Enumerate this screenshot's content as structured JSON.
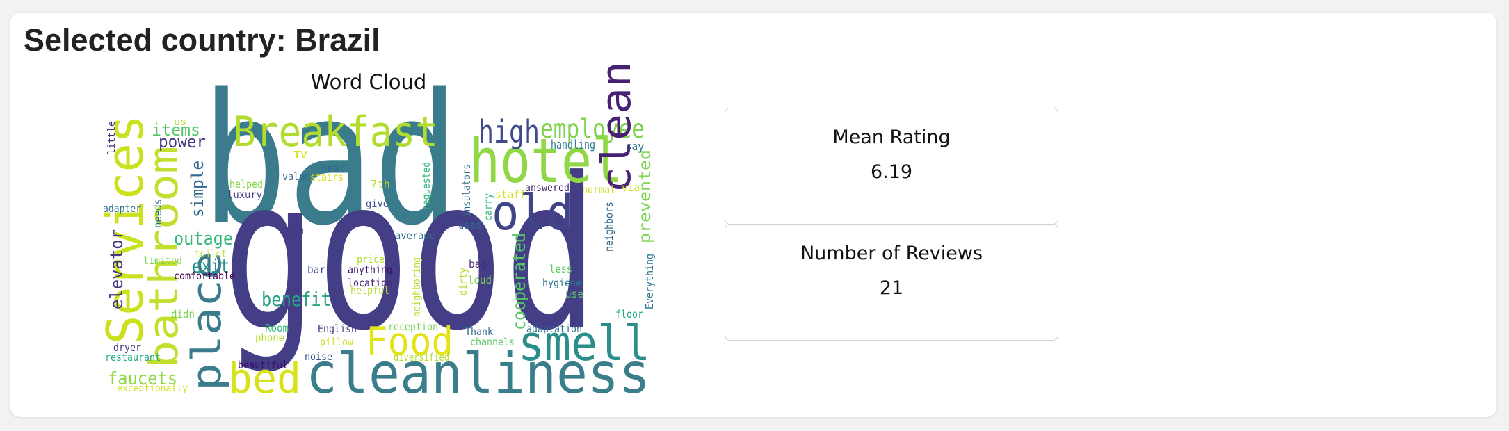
{
  "page": {
    "title": "Selected country: Brazil"
  },
  "wordcloud": {
    "title": "Word Cloud",
    "palette": {
      "dark_navy": "#433e85",
      "purple": "#482173",
      "teal": "#3a7e8c",
      "green": "#2fb47c",
      "light_green": "#8fd744",
      "lime": "#c3df2e",
      "yellow": "#e6e419"
    },
    "words": [
      {
        "text": "bad",
        "color": "#3b7c8c"
      },
      {
        "text": "good",
        "color": "#433e85"
      },
      {
        "text": "cleanliness",
        "color": "#3a7e8c"
      },
      {
        "text": "Breakfast",
        "color": "#b2dd2e"
      },
      {
        "text": "hotel",
        "color": "#8fd744"
      },
      {
        "text": "high",
        "color": "#3e4a89"
      },
      {
        "text": "employee",
        "color": "#7ed34f"
      },
      {
        "text": "old",
        "color": "#414487"
      },
      {
        "text": "clean",
        "color": "#482173"
      },
      {
        "text": "smell",
        "color": "#2c8e8b"
      },
      {
        "text": "Food",
        "color": "#e3e418"
      },
      {
        "text": "bed",
        "color": "#d7e219"
      },
      {
        "text": "Services",
        "color": "#cbe11e"
      },
      {
        "text": "bathroom",
        "color": "#c3df2e"
      },
      {
        "text": "place",
        "color": "#3b7c8c"
      },
      {
        "text": "items",
        "color": "#56c667"
      },
      {
        "text": "power",
        "color": "#453581"
      },
      {
        "text": "simple",
        "color": "#31688e"
      },
      {
        "text": "outage",
        "color": "#35b779"
      },
      {
        "text": "exit",
        "color": "#21918c"
      },
      {
        "text": "benefit",
        "color": "#29a386"
      },
      {
        "text": "elevator",
        "color": "#453781"
      },
      {
        "text": "faucets",
        "color": "#8fd744"
      },
      {
        "text": "cooperated",
        "color": "#56c667"
      },
      {
        "text": "prevented",
        "color": "#7ed34f"
      },
      {
        "text": "handling",
        "color": "#2a788e"
      },
      {
        "text": "say",
        "color": "#2c728e"
      },
      {
        "text": "us",
        "color": "#b5de2b"
      },
      {
        "text": "little",
        "color": "#472d7b"
      },
      {
        "text": "TV",
        "color": "#d8e219"
      },
      {
        "text": "hear",
        "color": "#31688e"
      },
      {
        "text": "value",
        "color": "#31688e"
      },
      {
        "text": "stairs",
        "color": "#d8e219"
      },
      {
        "text": "helped",
        "color": "#86d549"
      },
      {
        "text": "luxury",
        "color": "#443983"
      },
      {
        "text": "7th",
        "color": "#b5de2b"
      },
      {
        "text": "give",
        "color": "#3b528b"
      },
      {
        "text": "answered",
        "color": "#482878"
      },
      {
        "text": "normal",
        "color": "#d0e11c"
      },
      {
        "text": "via",
        "color": "#d0e11c"
      },
      {
        "text": "staff",
        "color": "#d0e11c"
      },
      {
        "text": "carry",
        "color": "#35b779"
      },
      {
        "text": "insulators",
        "color": "#2c728e"
      },
      {
        "text": "requested",
        "color": "#35b779"
      },
      {
        "text": "used",
        "color": "#31688e"
      },
      {
        "text": "neighbors",
        "color": "#31688e"
      },
      {
        "text": "Everything",
        "color": "#2a788e"
      },
      {
        "text": "adapter",
        "color": "#2c728e"
      },
      {
        "text": "needs",
        "color": "#2c728e"
      },
      {
        "text": "ruin",
        "color": "#443983"
      },
      {
        "text": "average",
        "color": "#2c728e"
      },
      {
        "text": "toilet",
        "color": "#b5de2b"
      },
      {
        "text": "limited",
        "color": "#7ad151"
      },
      {
        "text": "comfortable",
        "color": "#440154"
      },
      {
        "text": "price",
        "color": "#b5de2b"
      },
      {
        "text": "anything",
        "color": "#3b0f70"
      },
      {
        "text": "location",
        "color": "#482878"
      },
      {
        "text": "helpful",
        "color": "#b5de2b"
      },
      {
        "text": "bar",
        "color": "#3b528b"
      },
      {
        "text": "bag",
        "color": "#482878"
      },
      {
        "text": "loud",
        "color": "#7ad151"
      },
      {
        "text": "dirty",
        "color": "#b5de2b"
      },
      {
        "text": "less",
        "color": "#5ec962"
      },
      {
        "text": "hygiene",
        "color": "#2a788e"
      },
      {
        "text": "use",
        "color": "#5ec962"
      },
      {
        "text": "floor",
        "color": "#21a585"
      },
      {
        "text": "neighboring",
        "color": "#b5de2b"
      },
      {
        "text": "didn",
        "color": "#7ad151"
      },
      {
        "text": "Room",
        "color": "#35b779"
      },
      {
        "text": "phone",
        "color": "#b5de2b"
      },
      {
        "text": "English",
        "color": "#443983"
      },
      {
        "text": "pillow",
        "color": "#d0e11c"
      },
      {
        "text": "reception",
        "color": "#7ad151"
      },
      {
        "text": "diversified",
        "color": "#b5de2b"
      },
      {
        "text": "Thank",
        "color": "#31688e"
      },
      {
        "text": "channels",
        "color": "#5ec962"
      },
      {
        "text": "adaptation",
        "color": "#2c728e"
      },
      {
        "text": "dryer",
        "color": "#443983"
      },
      {
        "text": "restaurant",
        "color": "#22a884"
      },
      {
        "text": "noise",
        "color": "#3b528b"
      },
      {
        "text": "beautiful",
        "color": "#3b0f70"
      },
      {
        "text": "exceptionally",
        "color": "#d0e11c"
      }
    ]
  },
  "metrics": [
    {
      "label": "Mean Rating",
      "value": "6.19"
    },
    {
      "label": "Number of Reviews",
      "value": "21"
    }
  ]
}
